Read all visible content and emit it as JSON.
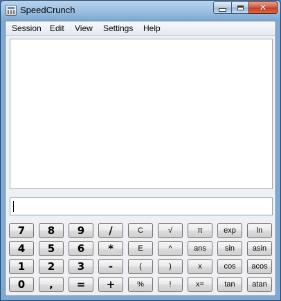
{
  "window": {
    "title": "SpeedCrunch",
    "minimize_icon": "minimize-icon",
    "maximize_icon": "maximize-icon",
    "close_glyph": "✕"
  },
  "menubar": [
    "Session",
    "Edit",
    "View",
    "Settings",
    "Help"
  ],
  "expression_input": {
    "value": "",
    "placeholder": ""
  },
  "keypad": [
    [
      "7",
      "8",
      "9",
      "/",
      "C",
      "√",
      "π",
      "exp",
      "ln"
    ],
    [
      "4",
      "5",
      "6",
      "*",
      "E",
      "^",
      "ans",
      "sin",
      "asin"
    ],
    [
      "1",
      "2",
      "3",
      "-",
      "(",
      ")",
      "x",
      "cos",
      "acos"
    ],
    [
      "0",
      ",",
      "=",
      "+",
      "%",
      "!",
      "x=",
      "tan",
      "atan"
    ]
  ]
}
